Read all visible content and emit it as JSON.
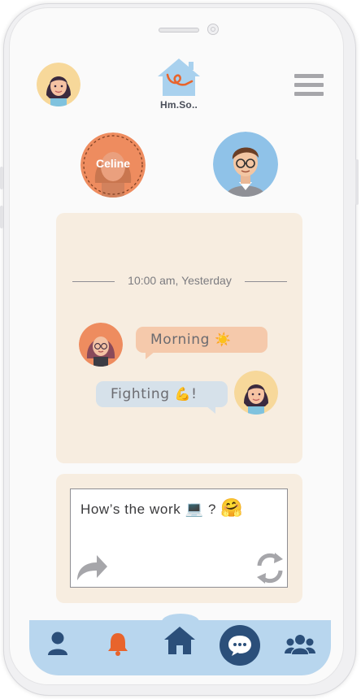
{
  "header": {
    "logo_text": "Hm.So..",
    "menu_icon": "hamburger-menu-icon"
  },
  "contacts": {
    "selected_name": "Celine"
  },
  "chat": {
    "timestamp": "10:00 am, Yesterday",
    "messages": [
      {
        "from": "contact",
        "text": "Morning",
        "emoji": "☀️"
      },
      {
        "from": "me",
        "text": "Fighting",
        "emoji": "💪",
        "suffix": "!"
      }
    ]
  },
  "composer": {
    "text": "How’s the work",
    "emoji_laptop": "💻",
    "suffix": "?",
    "emoji_hug": "🤗",
    "send_icon": "share-arrow-icon",
    "refresh_icon": "refresh-icon"
  },
  "tabbar": {
    "items": [
      "profile-icon",
      "bell-icon",
      "home-icon",
      "chat-icon",
      "group-icon"
    ],
    "active": "chat-icon"
  },
  "colors": {
    "panel": "#f7ede0",
    "tabbar": "#b8d6ee",
    "accent_dark": "#2b4f7a",
    "bell": "#e8642c",
    "bubble_in": "#f5c9ab",
    "bubble_out": "#d6e1ea"
  }
}
